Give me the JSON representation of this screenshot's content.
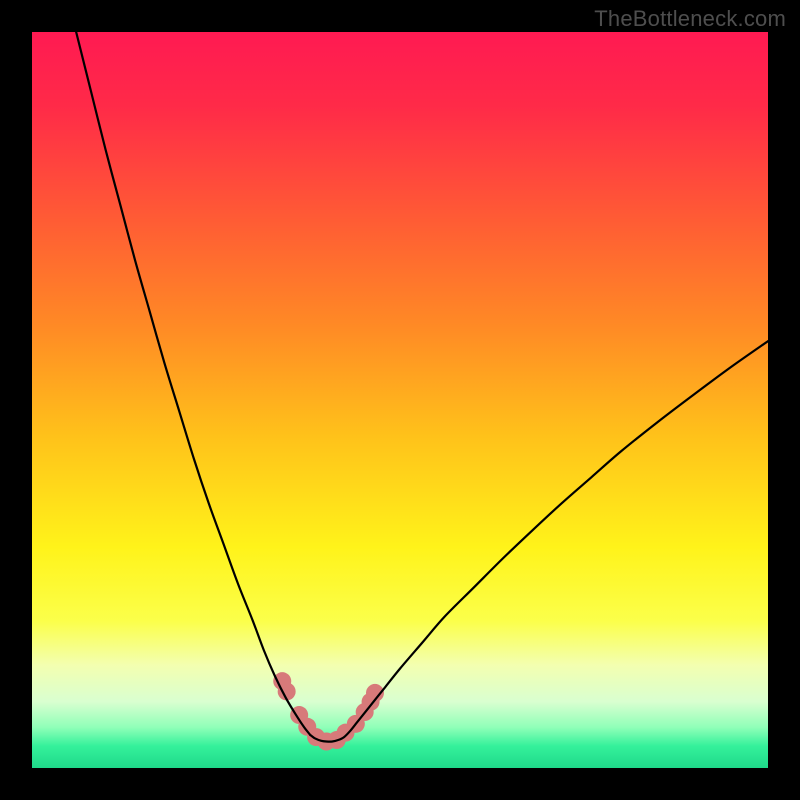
{
  "watermark": "TheBottleneck.com",
  "colors": {
    "black": "#000000",
    "curve": "#000000",
    "marker_fill": "#d77a7a",
    "marker_stroke": "#b85a5a"
  },
  "gradient_stops": [
    {
      "offset": 0.0,
      "color": "#ff1a52"
    },
    {
      "offset": 0.1,
      "color": "#ff2a48"
    },
    {
      "offset": 0.25,
      "color": "#ff5a35"
    },
    {
      "offset": 0.4,
      "color": "#ff8a25"
    },
    {
      "offset": 0.55,
      "color": "#ffc21a"
    },
    {
      "offset": 0.7,
      "color": "#fff31a"
    },
    {
      "offset": 0.8,
      "color": "#fbff4a"
    },
    {
      "offset": 0.86,
      "color": "#f3ffb0"
    },
    {
      "offset": 0.91,
      "color": "#d9ffd0"
    },
    {
      "offset": 0.945,
      "color": "#8fffb8"
    },
    {
      "offset": 0.97,
      "color": "#35f19b"
    },
    {
      "offset": 1.0,
      "color": "#1fd98a"
    }
  ],
  "chart_data": {
    "type": "line",
    "title": "",
    "xlabel": "",
    "ylabel": "",
    "xlim": [
      0,
      100
    ],
    "ylim": [
      0,
      100
    ],
    "grid": false,
    "series": [
      {
        "name": "left-branch",
        "x": [
          6,
          8,
          10,
          12,
          14,
          16,
          18,
          20,
          22,
          24,
          26,
          28,
          30,
          31.5,
          33,
          34.5,
          36,
          37.0,
          37.8
        ],
        "y": [
          100,
          92,
          84,
          76.5,
          69,
          62,
          55,
          48.5,
          42,
          36,
          30.5,
          25,
          20,
          16,
          12.5,
          9.5,
          7,
          5.5,
          4.5
        ]
      },
      {
        "name": "valley",
        "x": [
          37.8,
          38.5,
          39.3,
          40.0,
          40.8,
          41.6,
          42.4,
          43.2,
          44.0
        ],
        "y": [
          4.5,
          4.0,
          3.7,
          3.6,
          3.6,
          3.8,
          4.2,
          5.0,
          6.0
        ]
      },
      {
        "name": "right-branch",
        "x": [
          44.0,
          46,
          48,
          50,
          53,
          56,
          60,
          64,
          68,
          72,
          76,
          80,
          85,
          90,
          95,
          100
        ],
        "y": [
          6.0,
          8.5,
          11.0,
          13.5,
          17.0,
          20.5,
          24.5,
          28.5,
          32.3,
          36.0,
          39.5,
          43.0,
          47.0,
          50.8,
          54.5,
          58.0
        ]
      }
    ],
    "markers": {
      "name": "highlighted-points",
      "x": [
        34.0,
        34.6,
        36.3,
        37.4,
        38.6,
        40.0,
        41.4,
        42.6,
        44.0,
        45.2,
        46.0,
        46.6
      ],
      "y": [
        11.8,
        10.4,
        7.2,
        5.6,
        4.2,
        3.6,
        3.8,
        4.8,
        6.0,
        7.6,
        9.0,
        10.2
      ],
      "radius": 9
    }
  }
}
